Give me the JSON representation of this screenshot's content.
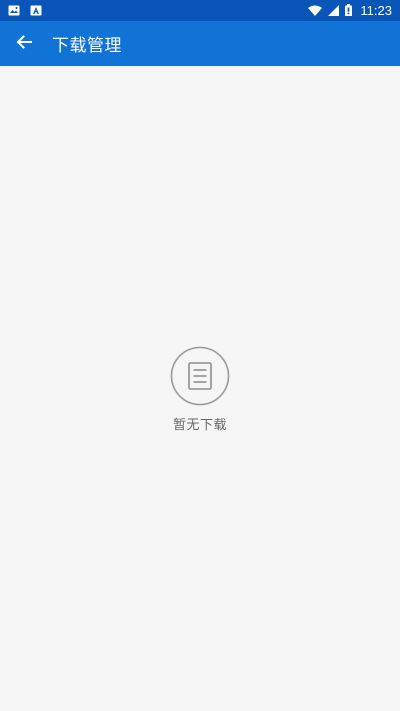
{
  "status_bar": {
    "time": "11:23",
    "left_icons": [
      "image-notification-icon",
      "app-notification-icon"
    ],
    "right_icons": [
      "wifi-icon",
      "signal-icon",
      "battery-icon"
    ],
    "bg_color": "#0a55b8"
  },
  "toolbar": {
    "title": "下载管理",
    "back_icon": "arrow-left-icon",
    "bg_color": "#1173d6"
  },
  "empty_state": {
    "icon": "document-list-icon",
    "message": "暂无下载"
  },
  "colors": {
    "background": "#f5f5f5",
    "empty_text": "#666666",
    "empty_icon": "#9a9a9a"
  }
}
